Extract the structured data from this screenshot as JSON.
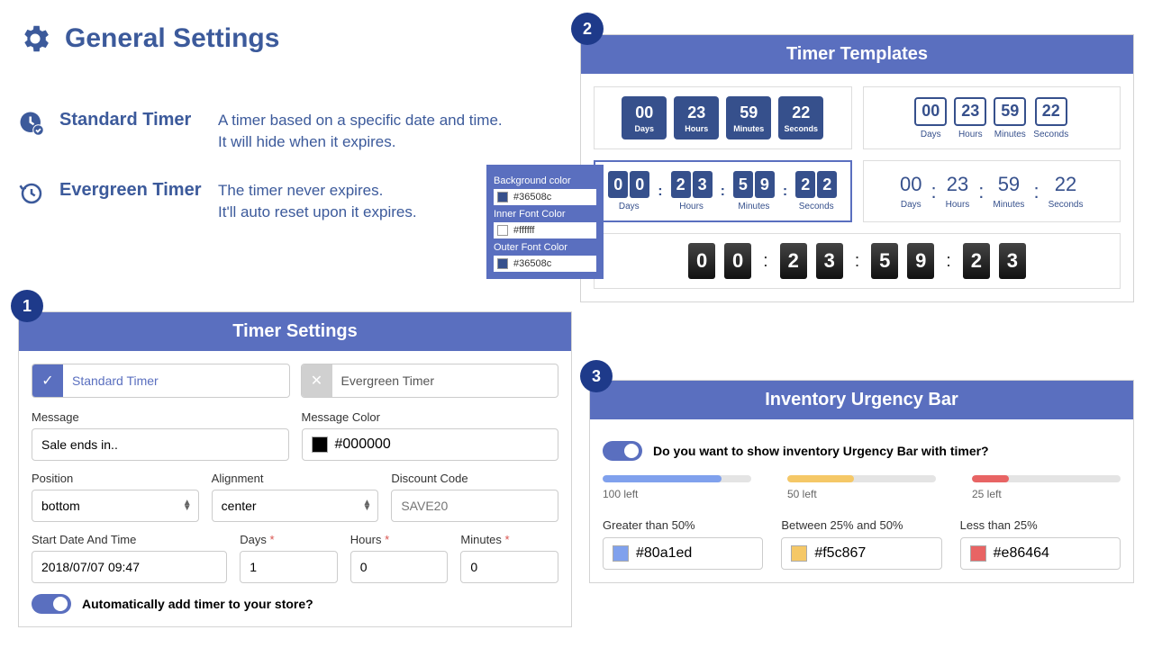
{
  "colors": {
    "primary": "#5a6fbf",
    "darkPrimary": "#3c5a9b"
  },
  "header": {
    "title": "General Settings"
  },
  "descriptions": {
    "standard": {
      "name": "Standard Timer",
      "desc": "A timer based on a specific date and time.\nIt will hide when it expires."
    },
    "evergreen": {
      "name": "Evergreen Timer",
      "desc": "The timer never expires.\nIt'll auto reset upon it expires."
    }
  },
  "colorPopup": {
    "bg": {
      "label": "Background color",
      "value": "#36508c"
    },
    "inner": {
      "label": "Inner Font Color",
      "value": "#ffffff"
    },
    "outer": {
      "label": "Outer Font Color",
      "value": "#36508c"
    }
  },
  "panel1": {
    "badge": "1",
    "title": "Timer Settings",
    "tabs": {
      "standard": "Standard Timer",
      "evergreen": "Evergreen Timer"
    },
    "message": {
      "label": "Message",
      "value": "Sale ends in.."
    },
    "messageColor": {
      "label": "Message Color",
      "value": "#000000"
    },
    "position": {
      "label": "Position",
      "value": "bottom"
    },
    "alignment": {
      "label": "Alignment",
      "value": "center"
    },
    "discount": {
      "label": "Discount Code",
      "placeholder": "SAVE20"
    },
    "startDate": {
      "label": "Start Date And Time",
      "value": "2018/07/07 09:47"
    },
    "days": {
      "label": "Days",
      "value": "1"
    },
    "hours": {
      "label": "Hours",
      "value": "0"
    },
    "minutes": {
      "label": "Minutes",
      "value": "0"
    },
    "autoAdd": "Automatically add timer to your store?"
  },
  "panel2": {
    "badge": "2",
    "title": "Timer Templates",
    "time": {
      "days": "00",
      "hours": "23",
      "minutes": "59",
      "seconds": "22",
      "seconds2": "23"
    },
    "labels": {
      "days": "Days",
      "hours": "Hours",
      "minutes": "Minutes",
      "seconds": "Seconds"
    }
  },
  "panel3": {
    "badge": "3",
    "title": "Inventory Urgency Bar",
    "question": "Do you want to show inventory Urgency Bar with timer?",
    "bars": {
      "b1": {
        "label": "100 left",
        "color": "#80a1ed",
        "width": "80%"
      },
      "b2": {
        "label": "50 left",
        "color": "#f5c867",
        "width": "45%"
      },
      "b3": {
        "label": "25 left",
        "color": "#e86464",
        "width": "25%"
      }
    },
    "rules": {
      "r1": {
        "label": "Greater than 50%",
        "value": "#80a1ed"
      },
      "r2": {
        "label": "Between 25% and 50%",
        "value": "#f5c867"
      },
      "r3": {
        "label": "Less than 25%",
        "value": "#e86464"
      }
    }
  }
}
